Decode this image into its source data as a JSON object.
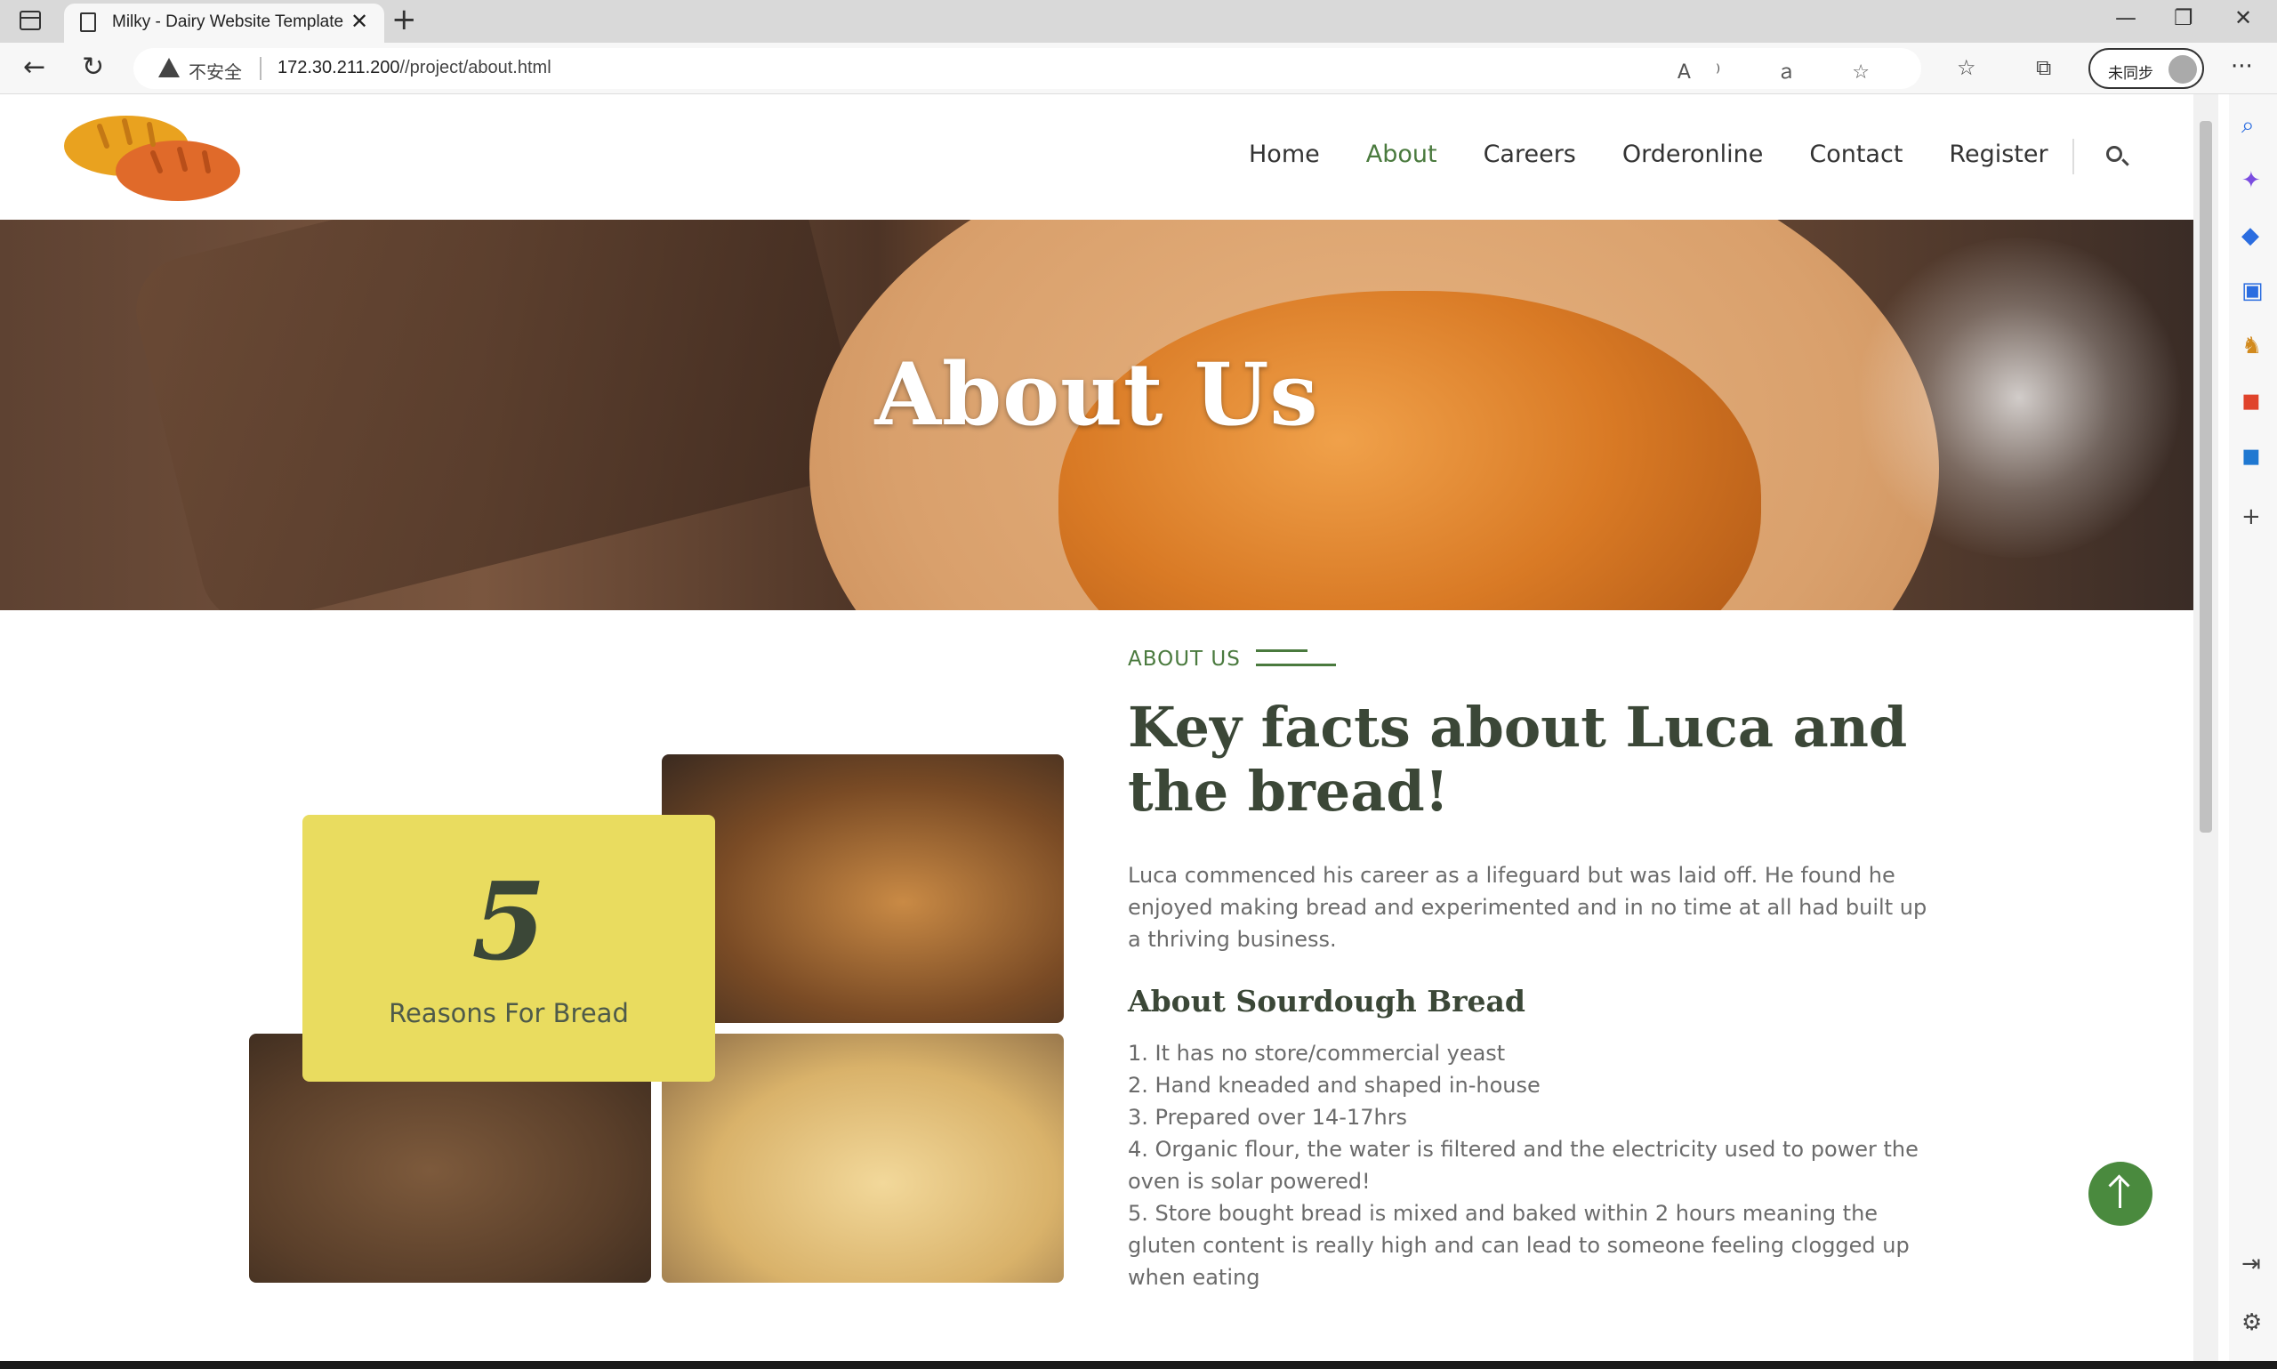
{
  "browser": {
    "tab_title": "Milky - Dairy Website Template",
    "security_label": "不安全",
    "url_host": "172.30.211.200",
    "url_path": "//project/about.html",
    "sync_label": "未同步"
  },
  "nav": {
    "items": [
      {
        "label": "Home"
      },
      {
        "label": "About"
      },
      {
        "label": "Careers"
      },
      {
        "label": "Orderonline"
      },
      {
        "label": "Contact"
      },
      {
        "label": "Register"
      }
    ],
    "active": "About"
  },
  "hero": {
    "title": "About Us"
  },
  "facts_badge": {
    "number": "5",
    "label": "Reasons For Bread"
  },
  "about": {
    "tag": "ABOUT US",
    "title": "Key facts about Luca and the bread!",
    "paragraph": "Luca commenced his career as a lifeguard but was laid off. He found he enjoyed making bread and experimented and in no time at all had built up a thriving business.",
    "subtitle": "About Sourdough Bread",
    "reasons": [
      "1. It has no store/commercial yeast",
      "2. Hand kneaded and shaped in-house",
      "3. Prepared over 14-17hrs",
      "4. Organic flour, the water is filtered and the electricity used to power the oven is solar powered!",
      "5. Store bought bread is mixed and baked within 2 hours meaning the gluten content is really high and can lead to someone feeling clogged up when eating"
    ]
  },
  "colors": {
    "accent_green": "#4a7a3e",
    "heading_dark": "#3b4737",
    "badge_yellow": "#e9dc5f"
  }
}
